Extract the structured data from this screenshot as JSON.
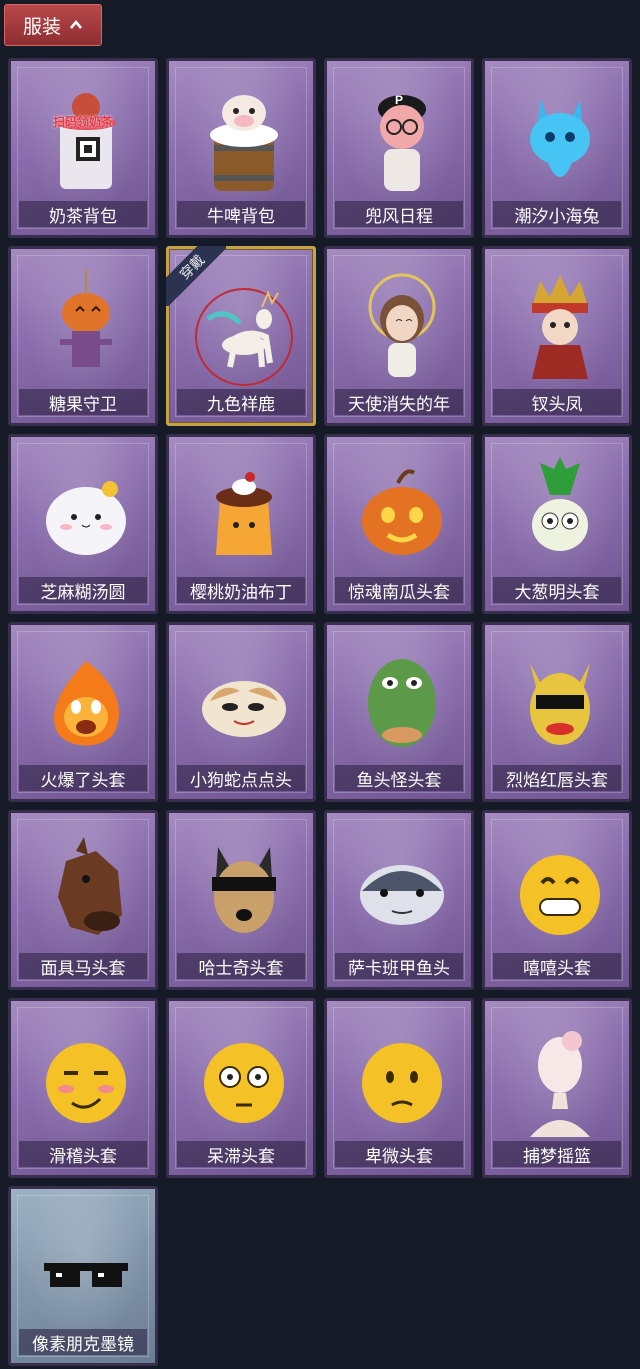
{
  "section": {
    "title": "服装"
  },
  "wear_badge": "穿戴",
  "items": [
    {
      "label": "奶茶背包",
      "icon": "milk-tea-backpack-icon",
      "tag_text": "扫码领奶茶"
    },
    {
      "label": "牛啤背包",
      "icon": "beer-barrel-backpack-icon"
    },
    {
      "label": "兜风日程",
      "icon": "cap-girl-pendant-icon",
      "tag_text": "P"
    },
    {
      "label": "潮汐小海兔",
      "icon": "blue-sea-rabbit-icon"
    },
    {
      "label": "糖果守卫",
      "icon": "pumpkin-scarecrow-icon"
    },
    {
      "label": "九色祥鹿",
      "icon": "nine-color-deer-icon"
    },
    {
      "label": "天使消失的年",
      "icon": "angel-girl-icon"
    },
    {
      "label": "钗头凤",
      "icon": "phoenix-crown-girl-icon"
    },
    {
      "label": "芝麻糊汤圆",
      "icon": "rice-dumpling-head-icon"
    },
    {
      "label": "樱桃奶油布丁",
      "icon": "cherry-pudding-head-icon"
    },
    {
      "label": "惊魂南瓜头套",
      "icon": "pumpkin-head-icon"
    },
    {
      "label": "大葱明头套",
      "icon": "scallion-head-icon"
    },
    {
      "label": "火爆了头套",
      "icon": "fire-head-icon"
    },
    {
      "label": "小狗蛇点点头",
      "icon": "dog-snake-head-icon"
    },
    {
      "label": "鱼头怪头套",
      "icon": "fish-monster-head-icon"
    },
    {
      "label": "烈焰红唇头套",
      "icon": "pikachu-sunglasses-head-icon"
    },
    {
      "label": "面具马头套",
      "icon": "horse-mask-icon"
    },
    {
      "label": "哈士奇头套",
      "icon": "husky-sunglasses-head-icon"
    },
    {
      "label": "萨卡班甲鱼头",
      "icon": "sacabambaspis-head-icon"
    },
    {
      "label": "嘻嘻头套",
      "icon": "grin-emoji-head-icon"
    },
    {
      "label": "滑稽头套",
      "icon": "funny-emoji-head-icon"
    },
    {
      "label": "呆滞头套",
      "icon": "dazed-emoji-head-icon"
    },
    {
      "label": "卑微头套",
      "icon": "humble-emoji-head-icon"
    },
    {
      "label": "捕梦摇篮",
      "icon": "dream-cradle-head-icon"
    },
    {
      "label": "像素朋克墨镜",
      "icon": "pixel-sunglasses-icon"
    }
  ],
  "selected_index": 5
}
